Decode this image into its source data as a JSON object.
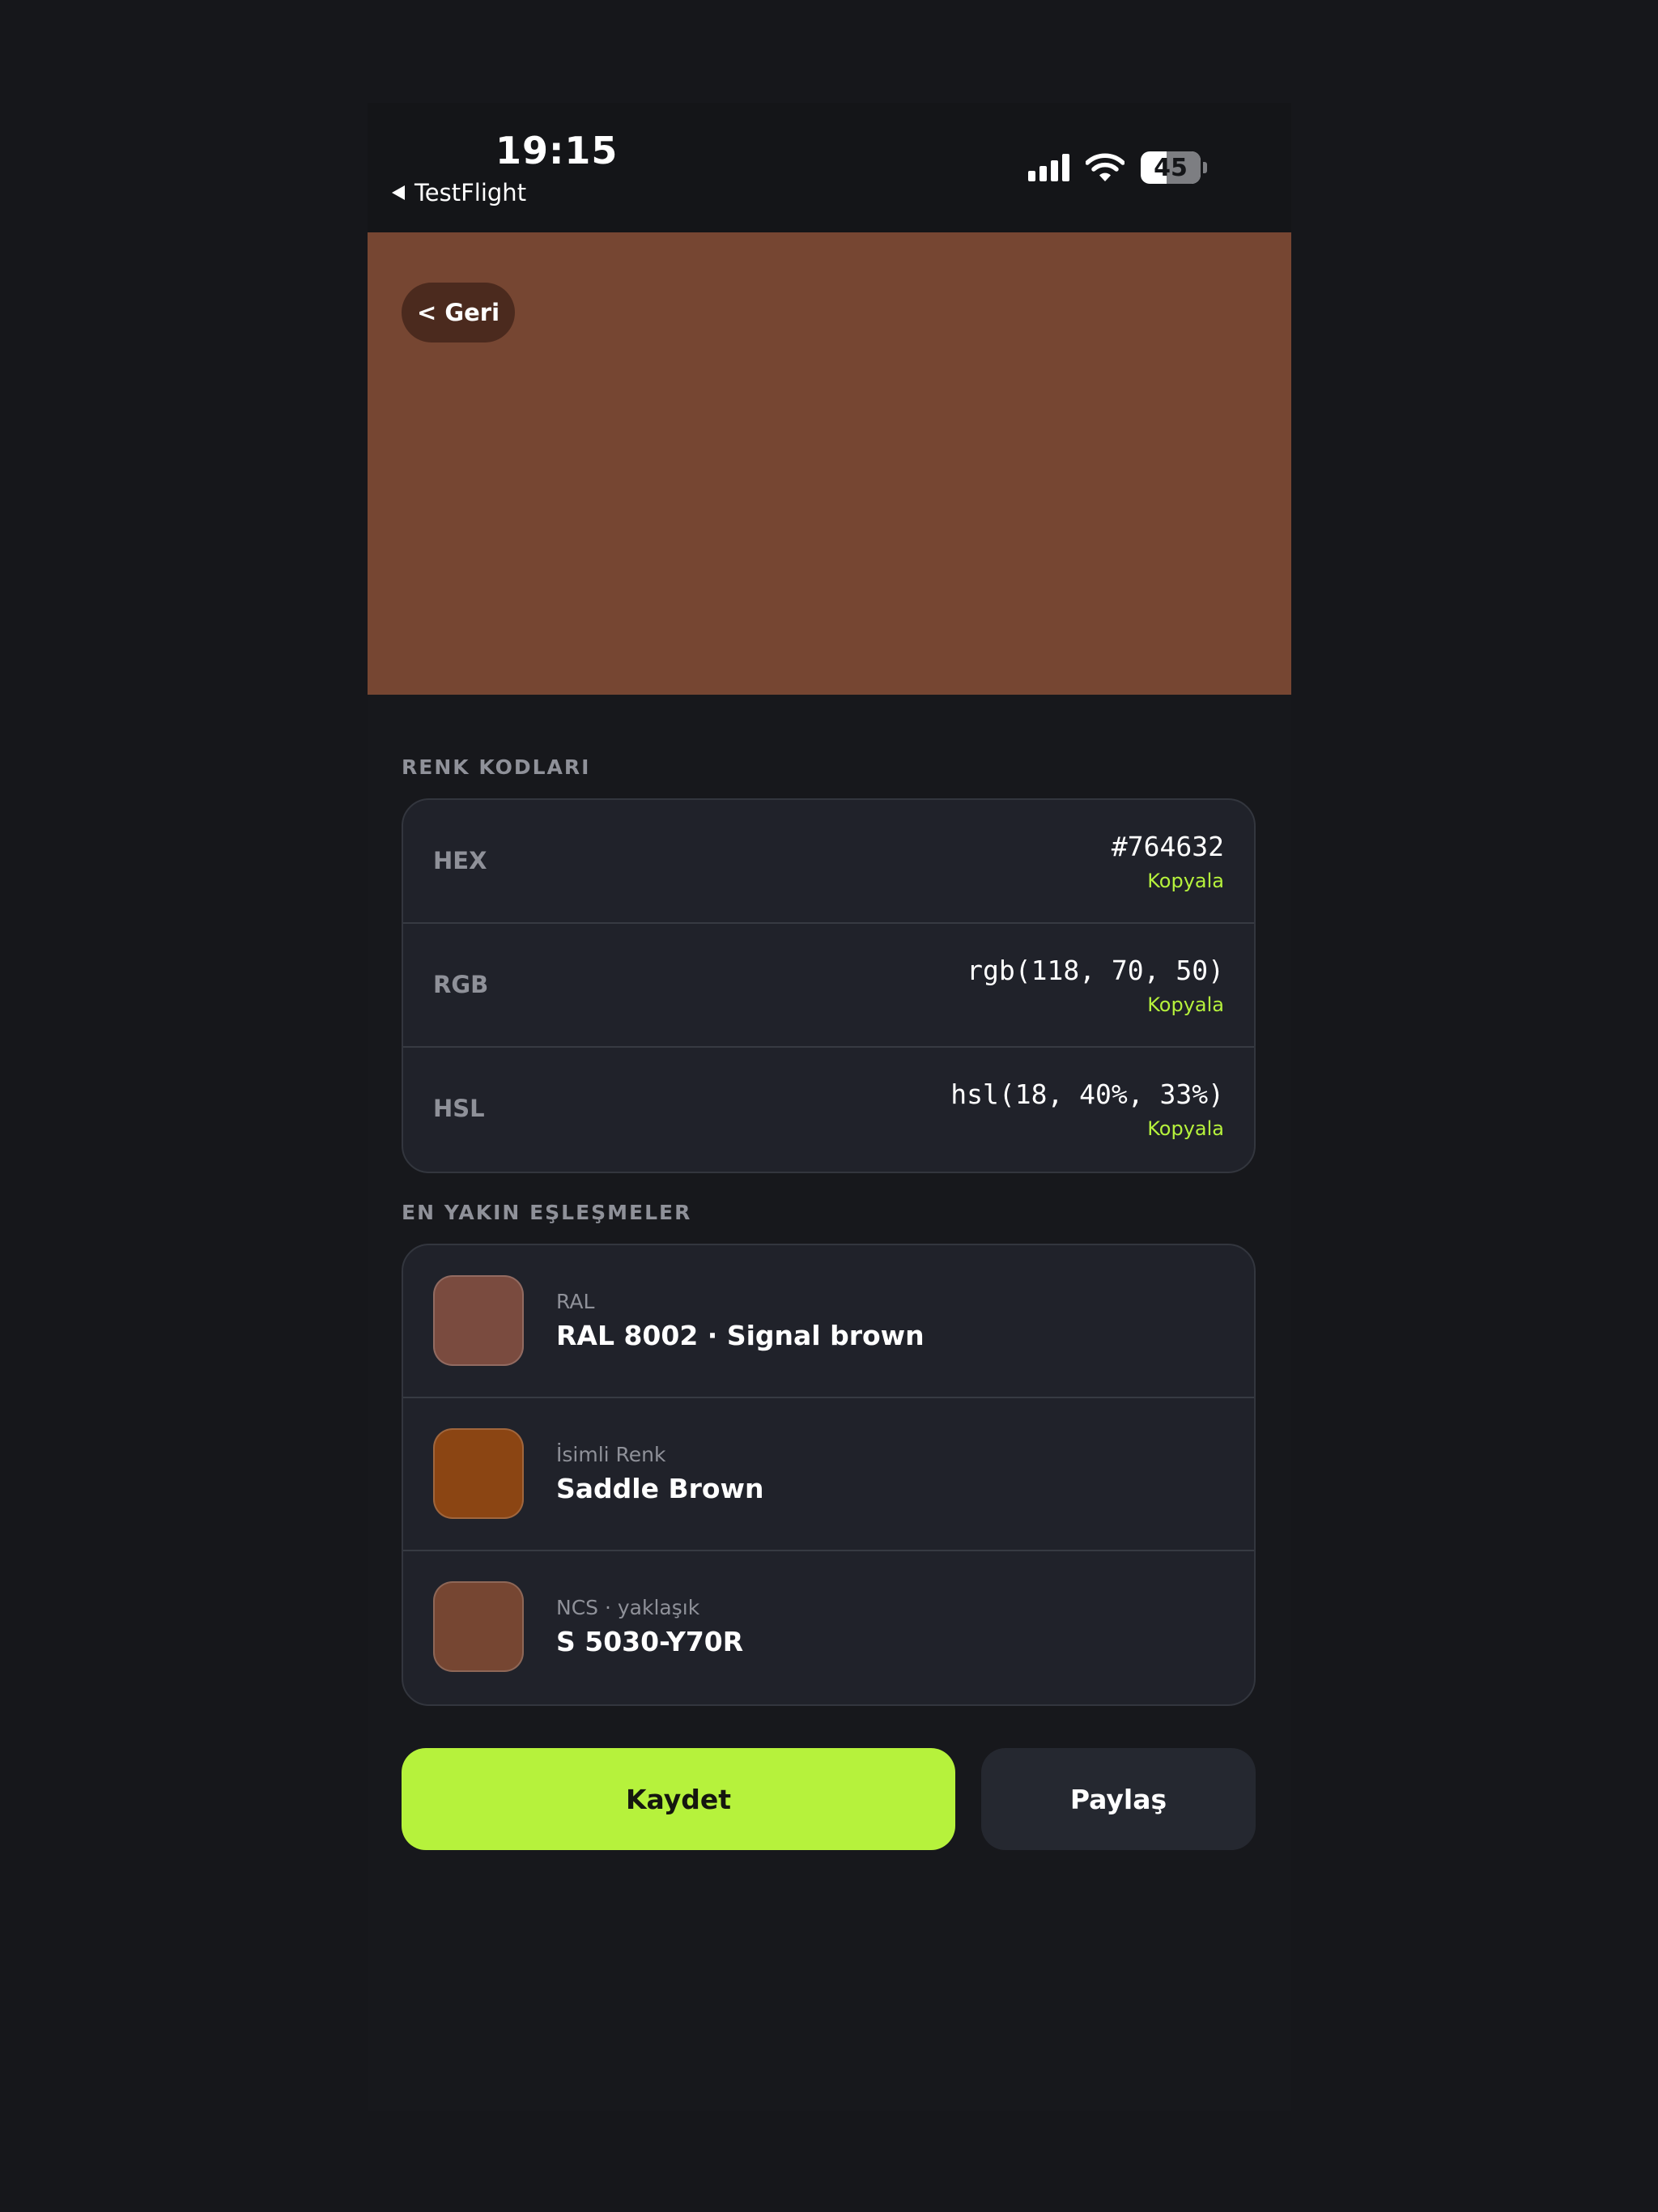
{
  "status_bar": {
    "time": "19:15",
    "back_app": "TestFlight",
    "battery_level": "45",
    "icons": [
      "cellular-signal-icon",
      "wifi-icon",
      "battery-icon"
    ]
  },
  "hero": {
    "color": "#764632",
    "back_label": "< Geri"
  },
  "codes": {
    "section_title": "RENK KODLARI",
    "rows": [
      {
        "label": "HEX",
        "value": "#764632",
        "copy": "Kopyala"
      },
      {
        "label": "RGB",
        "value": "rgb(118, 70, 50)",
        "copy": "Kopyala"
      },
      {
        "label": "HSL",
        "value": "hsl(18, 40%, 33%)",
        "copy": "Kopyala"
      }
    ]
  },
  "matches": {
    "section_title": "EN YAKIN EŞLEŞMELER",
    "rows": [
      {
        "system": "RAL",
        "name": "RAL 8002 · Signal brown",
        "swatch": "#7a4b3f"
      },
      {
        "system": "İsimli Renk",
        "name": "Saddle Brown",
        "swatch": "#8b4513"
      },
      {
        "system": "NCS · yaklaşık",
        "name": "S 5030-Y70R",
        "swatch": "#764632"
      }
    ]
  },
  "actions": {
    "save": "Kaydet",
    "share": "Paylaş"
  },
  "colors": {
    "accent": "#b6f23c",
    "background": "#16171b",
    "card": "#20222a"
  }
}
